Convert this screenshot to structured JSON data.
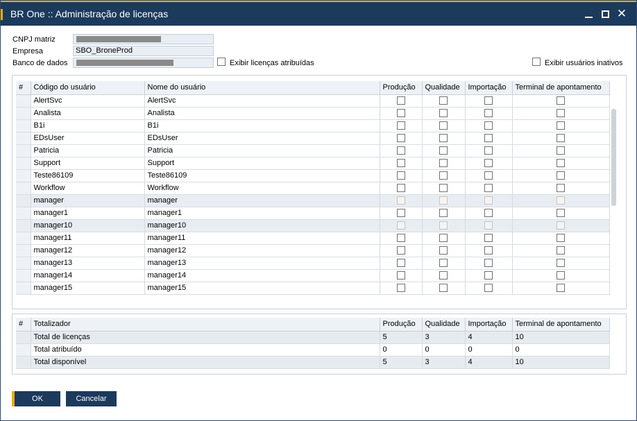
{
  "window": {
    "title": "BR One :: Administração de licenças",
    "minimize_icon": "minimize-icon",
    "maximize_icon": "maximize-icon",
    "close_glyph": "✕"
  },
  "header": {
    "cnpj_label": "CNPJ matriz",
    "empresa_label": "Empresa",
    "empresa_value": "SBO_BroneProd",
    "banco_label": "Banco de dados",
    "exibir_licencas_label": "Exibir licenças atribuídas",
    "exibir_inativos_label": "Exibir usuários inativos"
  },
  "users_grid": {
    "columns": [
      "#",
      "Código do usuário",
      "Nome do usuário",
      "Produção",
      "Qualidade",
      "Importação",
      "Terminal de apontamento"
    ],
    "rows": [
      {
        "code": "AlertSvc",
        "name": "AlertSvc",
        "disabled": false
      },
      {
        "code": "Analista",
        "name": "Analista",
        "disabled": false
      },
      {
        "code": "B1i",
        "name": "B1i",
        "disabled": false
      },
      {
        "code": "EDsUser",
        "name": "EDsUser",
        "disabled": false
      },
      {
        "code": "Patricia",
        "name": "Patricia",
        "disabled": false
      },
      {
        "code": "Support",
        "name": "Support",
        "disabled": false
      },
      {
        "code": "Teste86109",
        "name": "Teste86109",
        "disabled": false
      },
      {
        "code": "Workflow",
        "name": "Workflow",
        "disabled": false
      },
      {
        "code": "manager",
        "name": "manager",
        "disabled": true
      },
      {
        "code": "manager1",
        "name": "manager1",
        "disabled": false
      },
      {
        "code": "manager10",
        "name": "manager10",
        "disabled": true
      },
      {
        "code": "manager11",
        "name": "manager11",
        "disabled": false
      },
      {
        "code": "manager12",
        "name": "manager12",
        "disabled": false
      },
      {
        "code": "manager13",
        "name": "manager13",
        "disabled": false
      },
      {
        "code": "manager14",
        "name": "manager14",
        "disabled": false
      },
      {
        "code": "manager15",
        "name": "manager15",
        "disabled": false
      }
    ]
  },
  "totals_grid": {
    "columns": [
      "#",
      "Totalizador",
      "Produção",
      "Qualidade",
      "Importação",
      "Terminal de apontamento"
    ],
    "rows": [
      {
        "label": "Total de licenças",
        "values": [
          "5",
          "3",
          "4",
          "10"
        ]
      },
      {
        "label": "Total atribuído",
        "values": [
          "0",
          "0",
          "0",
          "0"
        ]
      },
      {
        "label": "Total disponível",
        "values": [
          "5",
          "3",
          "4",
          "10"
        ]
      }
    ]
  },
  "buttons": {
    "ok": "OK",
    "cancel": "Cancelar"
  },
  "colors": {
    "titlebar": "#1c3a5c",
    "accent": "#f0ab00"
  }
}
